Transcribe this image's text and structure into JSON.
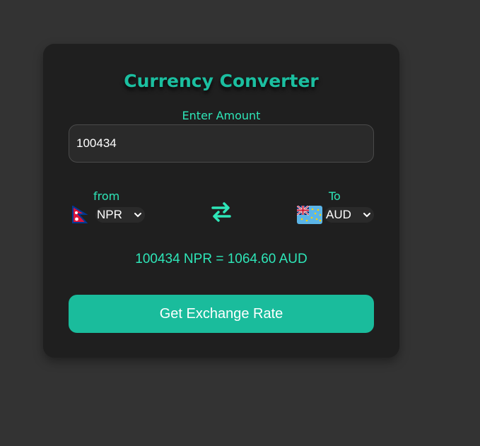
{
  "converter": {
    "title": "Currency Converter",
    "amount_label": "Enter Amount",
    "amount_value": "100434",
    "from_label": "from",
    "from_currency": "NPR",
    "from_flag_icon": "nepal-flag-icon",
    "to_label": "To",
    "to_currency": "AUD",
    "to_flag_icon": "tuvalu-flag-icon",
    "swap_icon": "exchange-arrows-icon",
    "result_text": "100434 NPR = 1064.60 AUD",
    "button_label": "Get Exchange Rate"
  },
  "colors": {
    "page_background": "#333333",
    "card_background": "#1f1f1f",
    "accent": "#1abc9c",
    "accent_text": "#2ee6b8"
  }
}
